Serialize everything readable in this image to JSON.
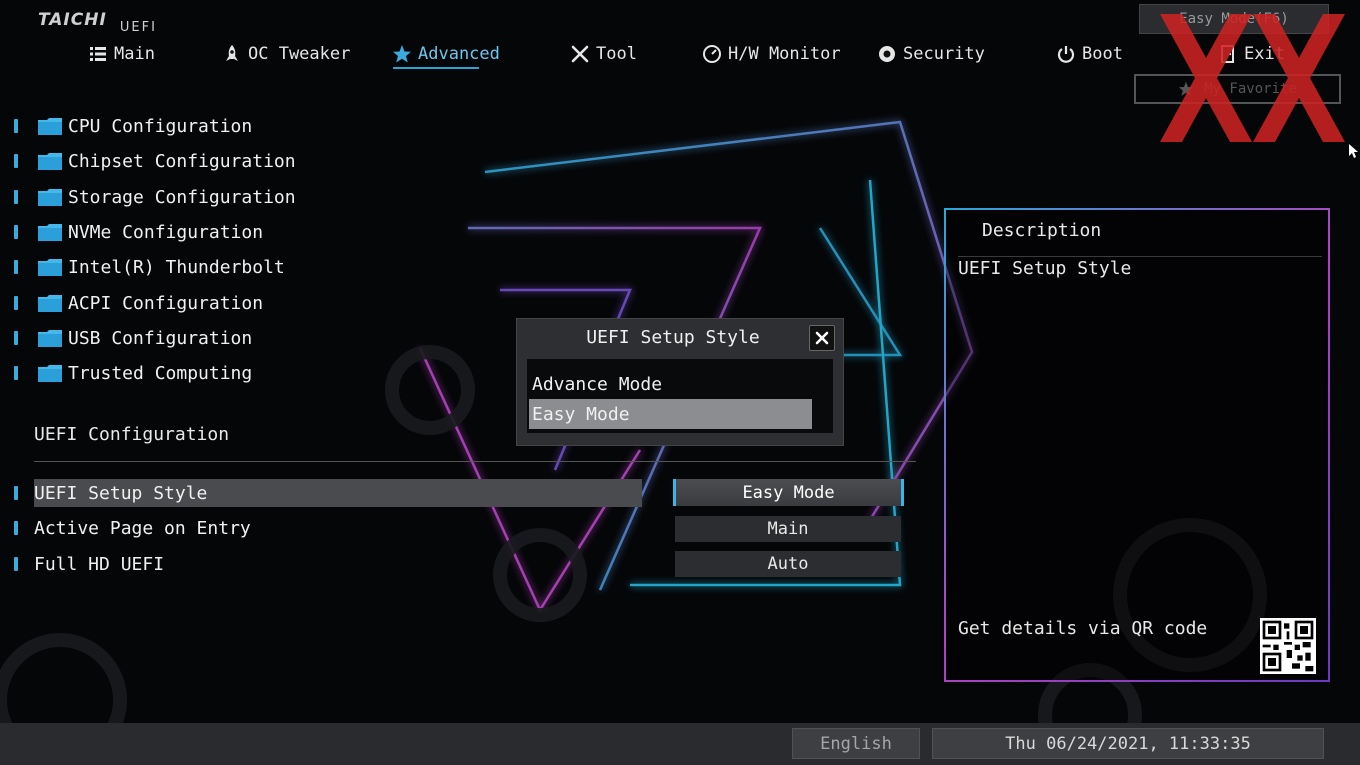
{
  "logo": {
    "brand": "TAICHI",
    "suffix": "UEFI"
  },
  "nav": [
    {
      "label": "Main",
      "icon": "list-icon"
    },
    {
      "label": "OC Tweaker",
      "icon": "rocket-icon"
    },
    {
      "label": "Advanced",
      "icon": "star-icon",
      "active": true
    },
    {
      "label": "Tool",
      "icon": "tools-icon"
    },
    {
      "label": "H/W Monitor",
      "icon": "monitor-icon"
    },
    {
      "label": "Security",
      "icon": "shield-gear-icon"
    },
    {
      "label": "Boot",
      "icon": "power-icon"
    },
    {
      "label": "Exit",
      "icon": "exit-door-icon"
    }
  ],
  "top_buttons": {
    "easy_mode": "Easy Mode(F6)",
    "my_favorite": "My Favorite"
  },
  "menu": [
    "CPU Configuration",
    "Chipset Configuration",
    "Storage Configuration",
    "NVMe Configuration",
    "Intel(R) Thunderbolt",
    "ACPI Configuration",
    "USB Configuration",
    "Trusted Computing"
  ],
  "uefi_section": {
    "title": "UEFI Configuration",
    "settings": [
      {
        "label": "UEFI Setup Style",
        "value": "Easy Mode",
        "selected": true
      },
      {
        "label": "Active Page on Entry",
        "value": "Main"
      },
      {
        "label": "Full HD UEFI",
        "value": "Auto"
      }
    ]
  },
  "popup": {
    "title": "UEFI Setup Style",
    "options": [
      "Advance Mode",
      "Easy Mode"
    ],
    "selected_option": "Easy Mode"
  },
  "description": {
    "header": "Description",
    "text": "UEFI Setup Style",
    "qr_text": "Get details via QR code"
  },
  "footer": {
    "language": "English",
    "datetime": "Thu 06/24/2021, 11:33:35"
  },
  "colors": {
    "accent": "#3aaadf",
    "active_nav": "#6cc8ee",
    "watermark": "#cc2222",
    "panel_border_start": "#2aa8d8",
    "panel_border_end": "#b043c0"
  }
}
